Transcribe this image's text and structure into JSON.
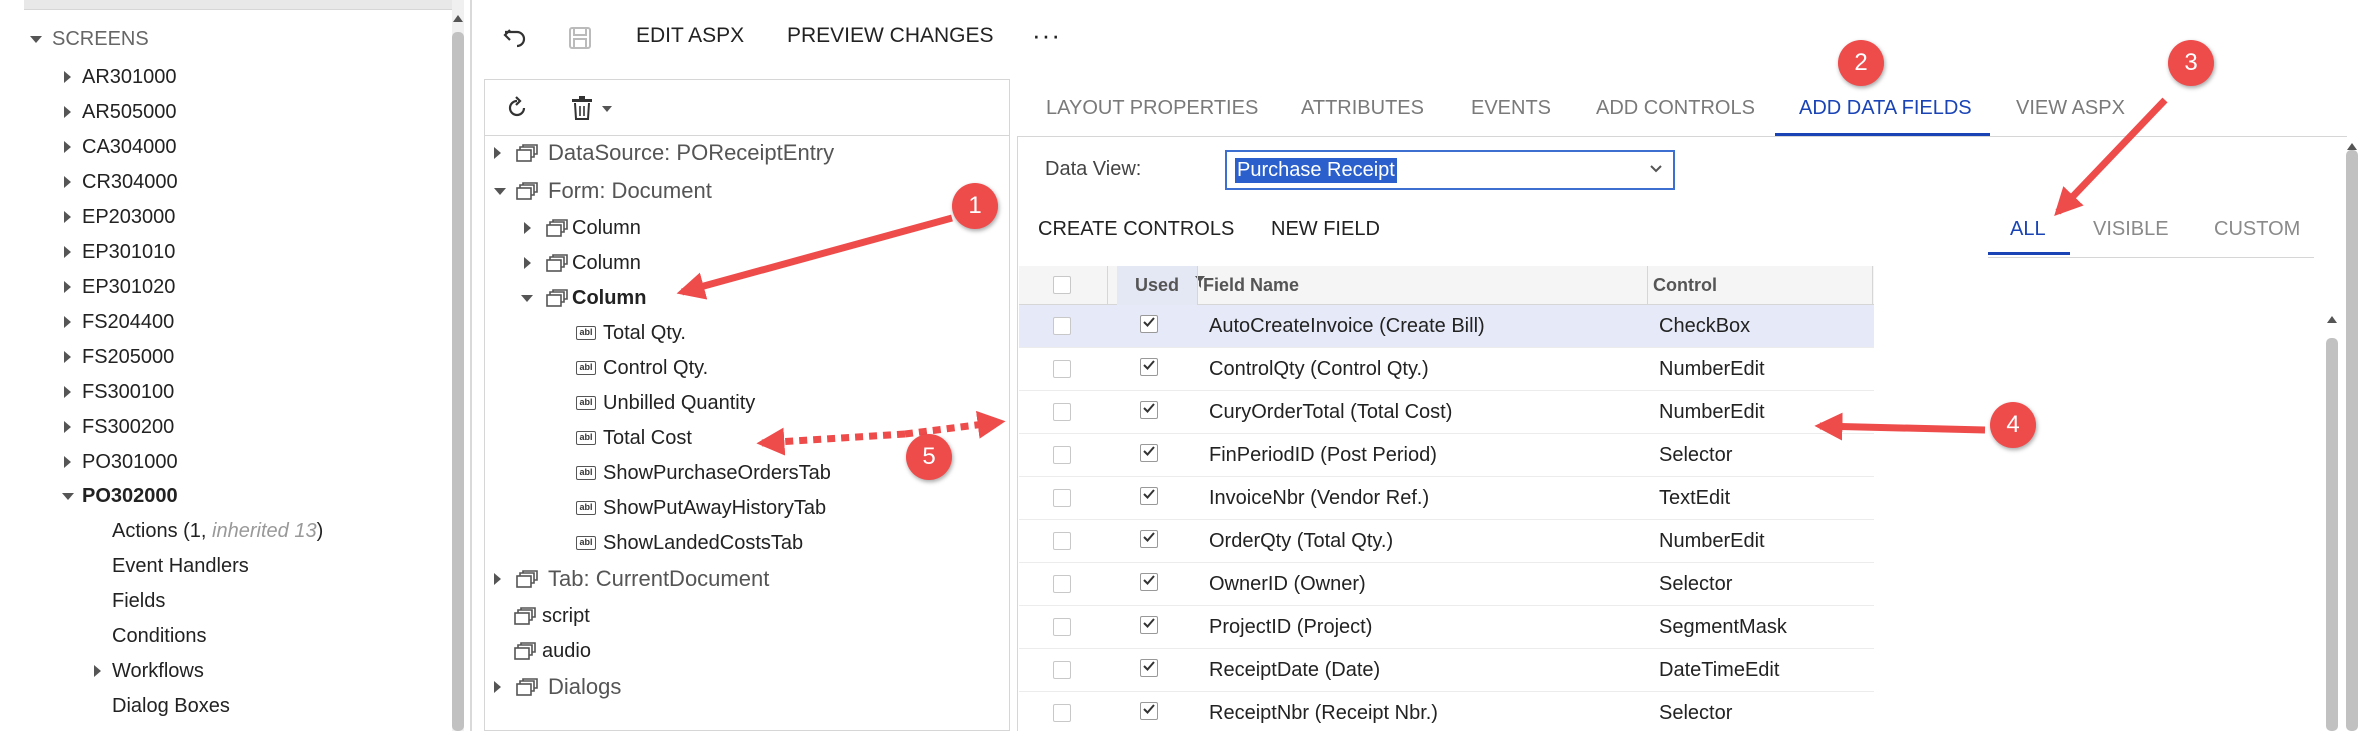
{
  "screens_tree": {
    "root_label": "SCREENS",
    "items": [
      "AR301000",
      "AR505000",
      "CA304000",
      "CR304000",
      "EP203000",
      "EP301010",
      "EP301020",
      "FS204400",
      "FS205000",
      "FS300100",
      "FS300200",
      "PO301000"
    ],
    "expanded_item": "PO302000",
    "children": {
      "actions_label": "Actions (1, ",
      "actions_inherited": "inherited 13",
      "actions_close": ")",
      "event_handlers": "Event Handlers",
      "fields": "Fields",
      "conditions": "Conditions",
      "workflows": "Workflows",
      "dialog_boxes": "Dialog Boxes"
    }
  },
  "toolbar": {
    "edit_aspx": "EDIT ASPX",
    "preview_changes": "PREVIEW CHANGES",
    "more": "···"
  },
  "element_tree": {
    "datasource": "DataSource: POReceiptEntry",
    "form": "Form: Document",
    "column1": "Column",
    "column2": "Column",
    "column3": "Column",
    "fields": [
      "Total Qty.",
      "Control Qty.",
      "Unbilled Quantity",
      "Total Cost",
      "ShowPurchaseOrdersTab",
      "ShowPutAwayHistoryTab",
      "ShowLandedCostsTab"
    ],
    "tab": "Tab: CurrentDocument",
    "script": "script",
    "audio": "audio",
    "dialogs": "Dialogs"
  },
  "tabs": [
    "LAYOUT PROPERTIES",
    "ATTRIBUTES",
    "EVENTS",
    "ADD CONTROLS",
    "ADD DATA FIELDS",
    "VIEW ASPX"
  ],
  "active_tab": "ADD DATA FIELDS",
  "data_view": {
    "label": "Data View:",
    "value": "Purchase Receipt"
  },
  "actions": {
    "create_controls": "CREATE CONTROLS",
    "new_field": "NEW FIELD"
  },
  "filters": {
    "all": "ALL",
    "visible": "VISIBLE",
    "custom": "CUSTOM",
    "active": "ALL"
  },
  "grid": {
    "headers": {
      "used": "Used",
      "field_name": "Field Name",
      "control": "Control"
    },
    "rows": [
      {
        "field": "AutoCreateInvoice (Create Bill)",
        "control": "CheckBox",
        "used": true,
        "selected": true
      },
      {
        "field": "ControlQty (Control Qty.)",
        "control": "NumberEdit",
        "used": true
      },
      {
        "field": "CuryOrderTotal (Total Cost)",
        "control": "NumberEdit",
        "used": true
      },
      {
        "field": "FinPeriodID (Post Period)",
        "control": "Selector",
        "used": true
      },
      {
        "field": "InvoiceNbr (Vendor Ref.)",
        "control": "TextEdit",
        "used": true
      },
      {
        "field": "OrderQty (Total Qty.)",
        "control": "NumberEdit",
        "used": true
      },
      {
        "field": "OwnerID (Owner)",
        "control": "Selector",
        "used": true
      },
      {
        "field": "ProjectID (Project)",
        "control": "SegmentMask",
        "used": true
      },
      {
        "field": "ReceiptDate (Date)",
        "control": "DateTimeEdit",
        "used": true
      },
      {
        "field": "ReceiptNbr (Receipt Nbr.)",
        "control": "Selector",
        "used": true
      }
    ]
  },
  "annotations": [
    "1",
    "2",
    "3",
    "4",
    "5"
  ],
  "colors": {
    "accent": "#1a44b6",
    "annotation": "#ee4b4b",
    "selected_row": "#e6eaf8"
  }
}
